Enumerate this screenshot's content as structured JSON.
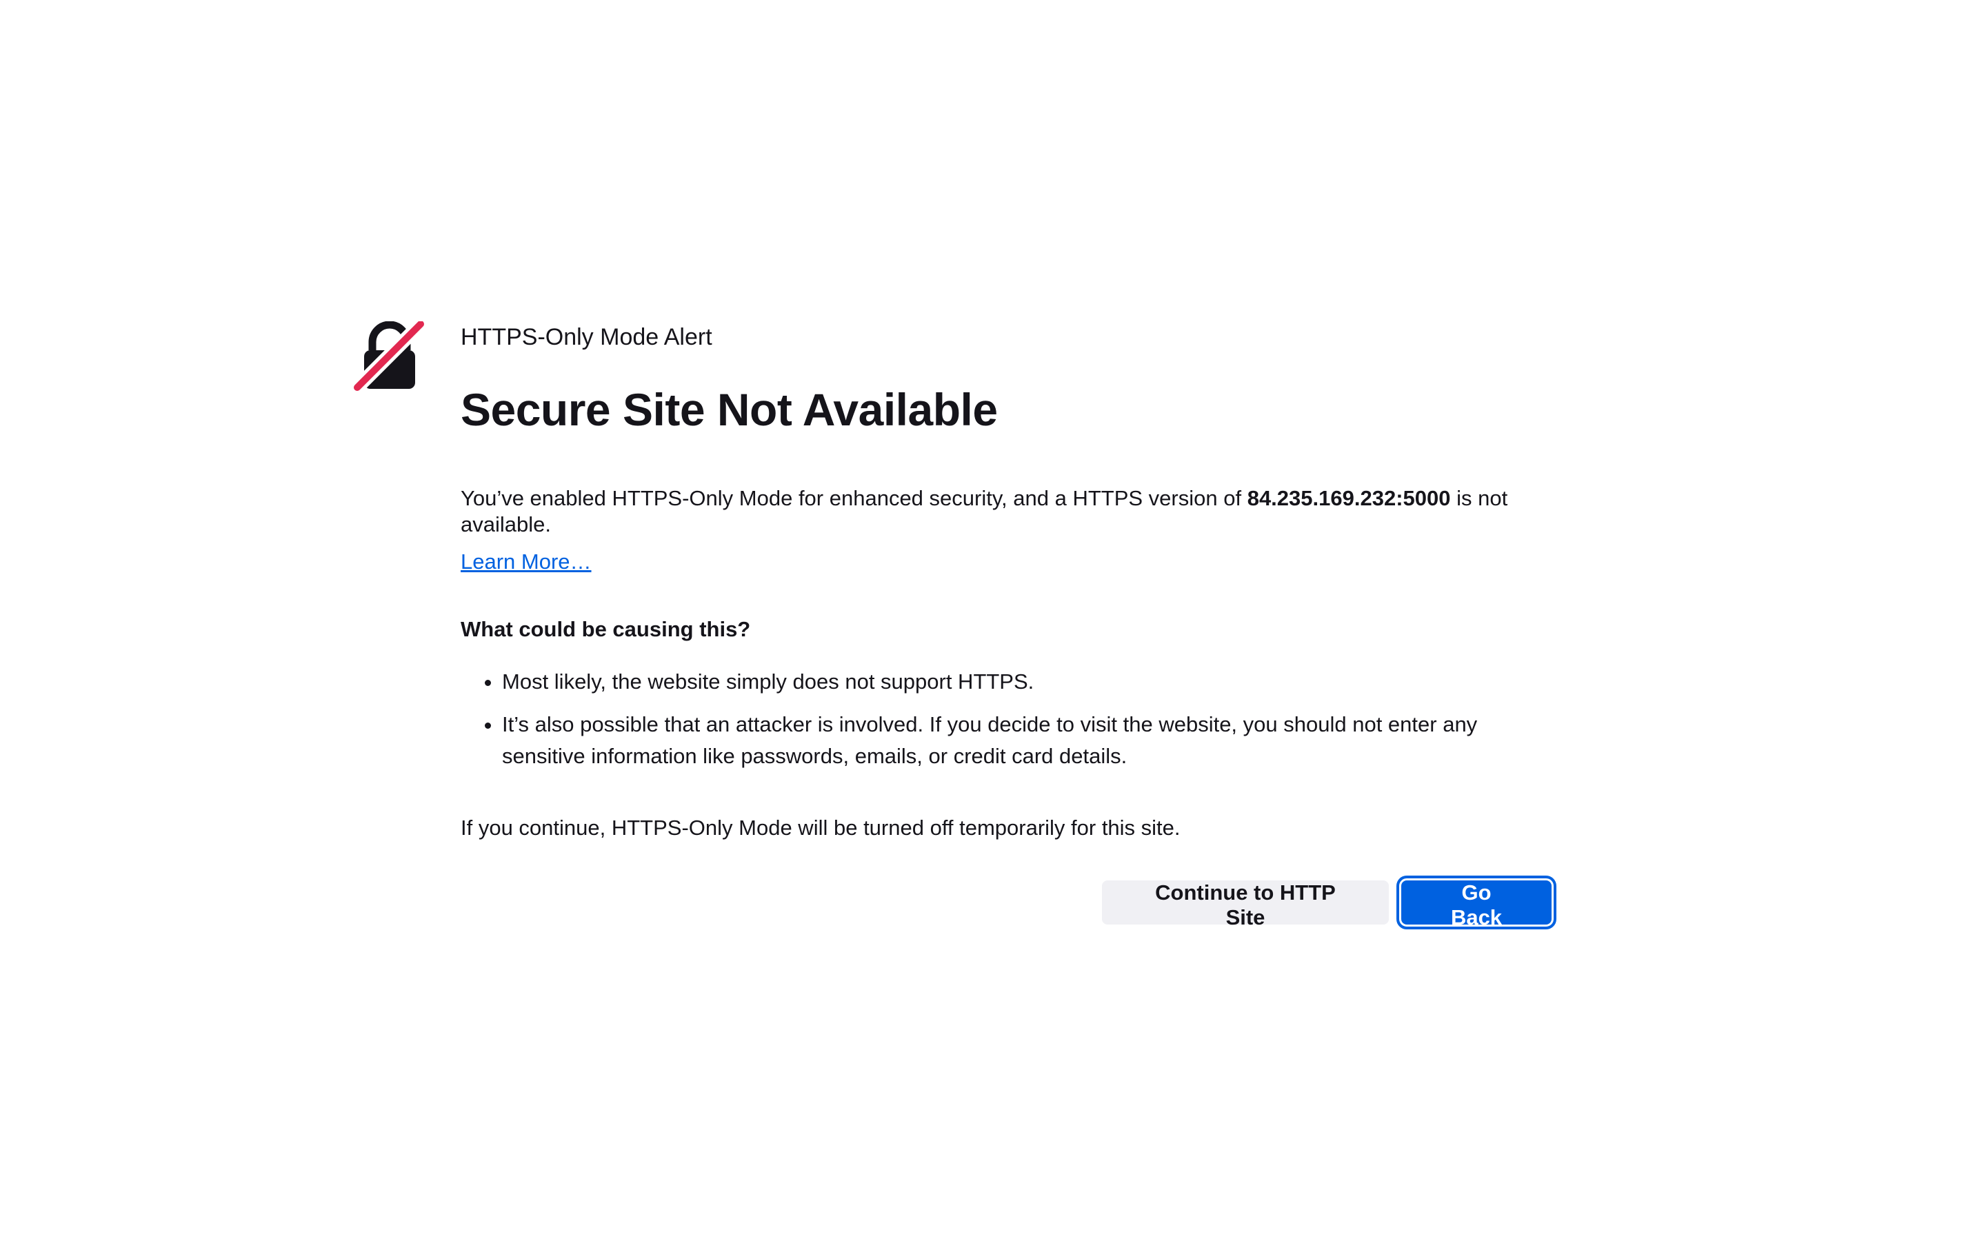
{
  "alert": {
    "subtitle": "HTTPS-Only Mode Alert",
    "title": "Secure Site Not Available",
    "icon": "lock-slash-icon",
    "description_before": "You’ve enabled HTTPS-Only Mode for enhanced security, and a HTTPS version of ",
    "host": "84.235.169.232:5000",
    "description_after": " is not available.",
    "learn_more": "Learn More…",
    "causes_heading": "What could be causing this?",
    "causes": [
      "Most likely, the website simply does not support HTTPS.",
      "It’s also possible that an attacker is involved. If you decide to visit the website, you should not enter any sensitive information like passwords, emails, or credit card details."
    ],
    "continue_note": "If you continue, HTTPS-Only Mode will be turned off temporarily for this site."
  },
  "buttons": {
    "continue_label": "Continue to HTTP Site",
    "go_back_label": "Go Back"
  },
  "colors": {
    "accent": "#0061e0",
    "slash": "#e22850",
    "text": "#15141a",
    "secondary_button": "#f0f0f4"
  }
}
